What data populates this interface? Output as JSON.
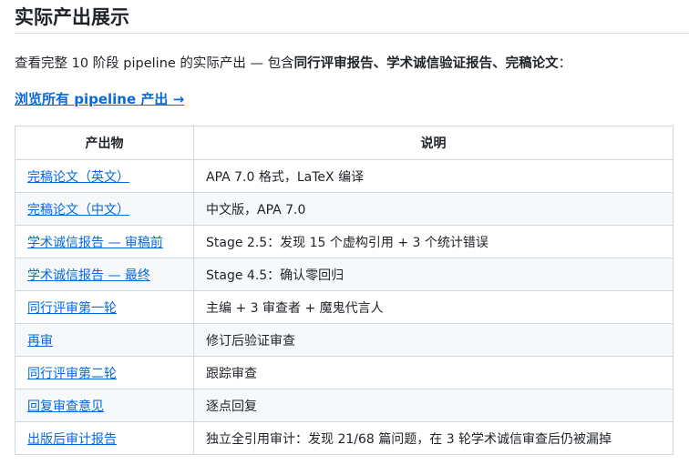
{
  "title": "实际产出展示",
  "intro": {
    "prefix": "查看完整 10 阶段 pipeline 的实际产出 — 包含",
    "bold": "同行评审报告、学术诚信验证报告、完稿论文",
    "suffix": "："
  },
  "browse_link": "浏览所有 pipeline 产出 →",
  "table": {
    "headers": [
      "产出物",
      "说明"
    ],
    "rows": [
      {
        "item": "完稿论文（英文）",
        "desc": "APA 7.0 格式，LaTeX 编译"
      },
      {
        "item": "完稿论文（中文）",
        "desc": "中文版，APA 7.0"
      },
      {
        "item": "学术诚信报告 — 审稿前",
        "desc": "Stage 2.5：发现 15 个虚构引用 + 3 个统计错误"
      },
      {
        "item": "学术诚信报告 — 最终",
        "desc": "Stage 4.5：确认零回归"
      },
      {
        "item": "同行评审第一轮",
        "desc": "主编 + 3 审查者 + 魔鬼代言人"
      },
      {
        "item": "再审",
        "desc": "修订后验证审查"
      },
      {
        "item": "同行评审第二轮",
        "desc": "跟踪审查"
      },
      {
        "item": "回复审查意见",
        "desc": "逐点回复"
      },
      {
        "item": "出版后审计报告",
        "desc": "独立全引用审计：发现 21/68 篇问题，在 3 轮学术诚信审查后仍被漏掉"
      }
    ]
  }
}
